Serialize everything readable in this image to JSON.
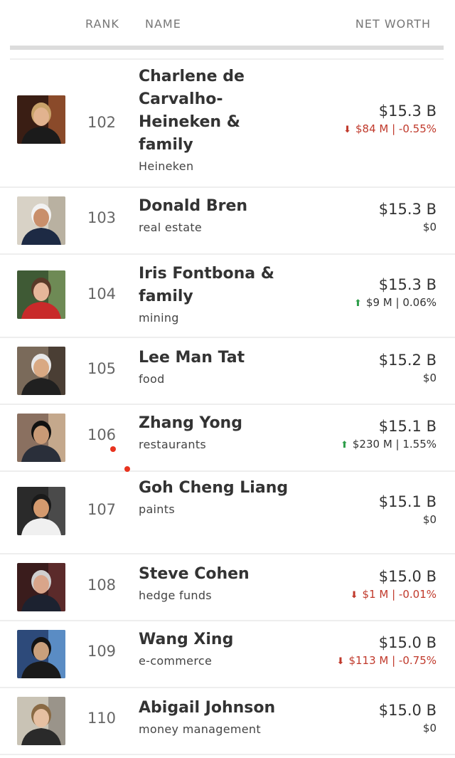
{
  "header": {
    "rank_label": "RANK",
    "name_label": "NAME",
    "worth_label": "NET WORTH"
  },
  "rows": [
    {
      "rank": "102",
      "name": "Charlene de Carvalho-Heineken & family",
      "source": "Heineken",
      "worth": "$15.3 B",
      "change": "$84 M | -0.55%",
      "direction": "down"
    },
    {
      "rank": "103",
      "name": "Donald Bren",
      "source": "real estate",
      "worth": "$15.3 B",
      "change": "$0",
      "direction": "none"
    },
    {
      "rank": "104",
      "name": "Iris Fontbona & family",
      "source": "mining",
      "worth": "$15.3 B",
      "change": "$9 M | 0.06%",
      "direction": "up"
    },
    {
      "rank": "105",
      "name": "Lee Man Tat",
      "source": "food",
      "worth": "$15.2 B",
      "change": "$0",
      "direction": "none"
    },
    {
      "rank": "106",
      "name": "Zhang Yong",
      "source": "restaurants",
      "worth": "$15.1 B",
      "change": "$230 M | 1.55%",
      "direction": "up"
    },
    {
      "rank": "107",
      "name": "Goh Cheng Liang",
      "source": "paints",
      "worth": "$15.1 B",
      "change": "$0",
      "direction": "none"
    },
    {
      "rank": "108",
      "name": "Steve Cohen",
      "source": "hedge funds",
      "worth": "$15.0 B",
      "change": "$1 M | -0.01%",
      "direction": "down"
    },
    {
      "rank": "109",
      "name": "Wang Xing",
      "source": "e-commerce",
      "worth": "$15.0 B",
      "change": "$113 M | -0.75%",
      "direction": "down"
    },
    {
      "rank": "110",
      "name": "Abigail Johnson",
      "source": "money management",
      "worth": "$15.0 B",
      "change": "$0",
      "direction": "none"
    }
  ],
  "colors": {
    "down": "#c0392b",
    "up_arrow": "#2e9e4a",
    "indicator_dot": "#e8331f",
    "divider": "#eeeeee"
  },
  "icons": {
    "down": "arrow-down-icon",
    "up": "arrow-up-icon"
  }
}
